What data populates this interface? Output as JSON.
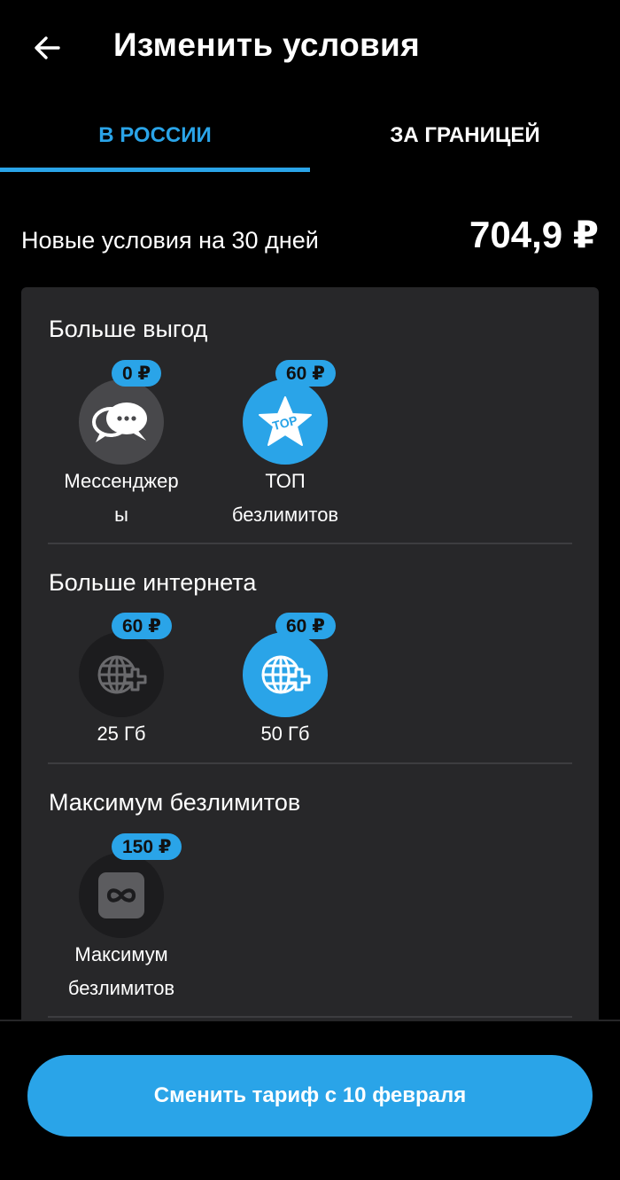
{
  "header": {
    "back_icon": "arrow-left-icon",
    "title": "Изменить условия"
  },
  "tabs": [
    {
      "label": "В РОССИИ",
      "active": true
    },
    {
      "label": "ЗА ГРАНИЦЕЙ",
      "active": false
    }
  ],
  "summary": {
    "label": "Новые условия на 30 дней",
    "price": "704,9 ₽"
  },
  "sections": [
    {
      "title": "Больше выгод",
      "options": [
        {
          "price": "0 ₽",
          "label_line1": "Мессенджер",
          "label_line2": "ы",
          "icon": "chat-bubbles-icon"
        },
        {
          "price": "60 ₽",
          "label_line1": "ТОП",
          "label_line2": "безлимитов",
          "icon": "top-star-icon",
          "icon_text": "TOP"
        }
      ]
    },
    {
      "title": "Больше интернета",
      "options": [
        {
          "price": "60 ₽",
          "label_line1": "25 Гб",
          "icon": "globe-plus-icon"
        },
        {
          "price": "60 ₽",
          "label_line1": "50 Гб",
          "icon": "globe-plus-icon"
        }
      ]
    },
    {
      "title": "Максимум безлимитов",
      "options": [
        {
          "price": "150 ₽",
          "label_line1": "Максимум",
          "label_line2": "безлимитов",
          "icon": "infinity-icon"
        }
      ]
    }
  ],
  "cta": {
    "label": "Сменить тариф с 10 февраля"
  },
  "colors": {
    "accent": "#2aa4e8",
    "panel": "#272729",
    "background": "#000000"
  }
}
